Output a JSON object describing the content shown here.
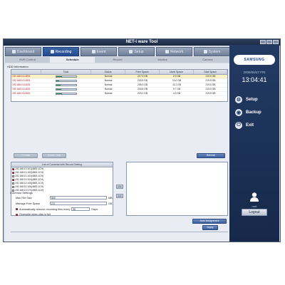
{
  "window": {
    "title": "NET-i ware Tool"
  },
  "tabs": [
    {
      "label": "Dashboard",
      "icon": "dashboard-icon"
    },
    {
      "label": "Recording",
      "icon": "recording-icon",
      "active": true
    },
    {
      "label": "Event",
      "icon": "event-icon"
    },
    {
      "label": "Setup",
      "icon": "setup-icon"
    },
    {
      "label": "Network",
      "icon": "network-icon"
    },
    {
      "label": "System",
      "icon": "system-icon"
    }
  ],
  "subtabs": [
    {
      "label": "NVR Control"
    },
    {
      "label": "Schedule",
      "active": true
    },
    {
      "label": "Record"
    },
    {
      "label": "Monitor"
    },
    {
      "label": "Camera"
    }
  ],
  "hdd": {
    "section_label": "HDD Information",
    "columns": [
      "",
      "Total",
      "Status",
      "Free Space",
      "Used Space",
      "Total Space"
    ],
    "rows": [
      {
        "name": "192.168.0.1:4531",
        "fill": 0.28,
        "status": "Normal",
        "free": "217.5 GB",
        "used": "2.0 GB",
        "total": "219.5 GB",
        "selected": true
      },
      {
        "name": "192.168.0.2:4531",
        "fill": 0.15,
        "status": "Normal",
        "free": "209.5 GB",
        "used": "10.0 GB",
        "total": "219.5 GB"
      },
      {
        "name": "192.168.0.3:4531",
        "fill": 0.22,
        "status": "Normal",
        "free": "208.3 GB",
        "used": "11.2 GB",
        "total": "219.5 GB"
      },
      {
        "name": "192.168.0.4:4531",
        "fill": 0.25,
        "status": "Normal",
        "free": "209.8 GB",
        "used": "9.7 GB",
        "total": "219.5 GB"
      },
      {
        "name": "192.168.0.5:4531",
        "fill": 0.3,
        "status": "Normal",
        "free": "215.2 GB",
        "used": "4.3 GB",
        "total": "219.5 GB"
      }
    ],
    "refresh_label": "Refresh",
    "format_label": "Format",
    "check_label": "Check Disk"
  },
  "camera_list": {
    "title": "List of Cameras with Record Setting",
    "items": [
      {
        "label": "192.168.10.101(4800-1CH)",
        "checked": true
      },
      {
        "label": "192.168.10.102(4800-1CH)",
        "checked": true
      },
      {
        "label": "192.168.10.103(4800-1CH)",
        "checked": false
      },
      {
        "label": "192.168.10.104(4800-1CH)",
        "checked": true
      },
      {
        "label": "192.168.10.105(4800-1CH)",
        "checked": false
      },
      {
        "label": "192.168.10.106(4800-1CH)",
        "checked": false
      },
      {
        "label": "192.168.10.170(4800-1CH)",
        "checked": false
      }
    ],
    "add_arrow": ">>",
    "remove_arrow": "<<",
    "assign_label": "Auto Assignment"
  },
  "common_settings": {
    "section_label": "Common Settings",
    "max_file_size_label": "Max File Size",
    "max_file_size_value": "500",
    "max_file_size_unit": "MB",
    "manage_free_space_label": "Manage Free Space",
    "manage_free_space_value": "2.0",
    "manage_free_space_unit": "GB",
    "auto_remove_label": "Automatically remove recording files every",
    "auto_remove_value": "30",
    "auto_remove_unit": "Days",
    "overwrite_label": "Overwrite when disk is full",
    "apply_label": "Apply"
  },
  "side": {
    "brand": "SAMSUNG",
    "date": "2009/06/27 FRI",
    "time": "13:04:41",
    "setup_label": "Setup",
    "backup_label": "Backup",
    "exit_label": "Exit",
    "user": "root",
    "logout_label": "Logout"
  }
}
